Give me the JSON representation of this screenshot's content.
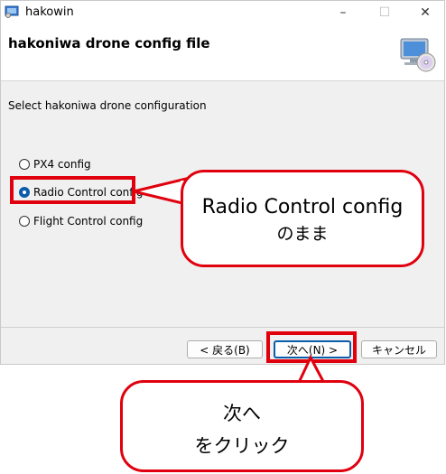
{
  "window": {
    "title": "hakowin",
    "minimize_glyph": "–",
    "maximize_glyph": "☐",
    "close_glyph": "✕"
  },
  "header": {
    "title": "hakoniwa drone config file",
    "icon": "computer-cd-icon"
  },
  "main": {
    "instruction": "Select hakoniwa drone configuration",
    "options": [
      {
        "label": "PX4 config",
        "checked": false
      },
      {
        "label": "Radio Control config",
        "checked": true
      },
      {
        "label": "Flight Control config",
        "checked": false
      }
    ]
  },
  "buttons": {
    "back": "< 戻る(B)",
    "next": "次へ(N) >",
    "cancel": "キャンセル"
  },
  "annotations": {
    "callout_radio_line1": "Radio Control config",
    "callout_radio_line2": "のまま",
    "callout_next_line1": "次へ",
    "callout_next_line2": "をクリック",
    "color": "#e0000e"
  }
}
